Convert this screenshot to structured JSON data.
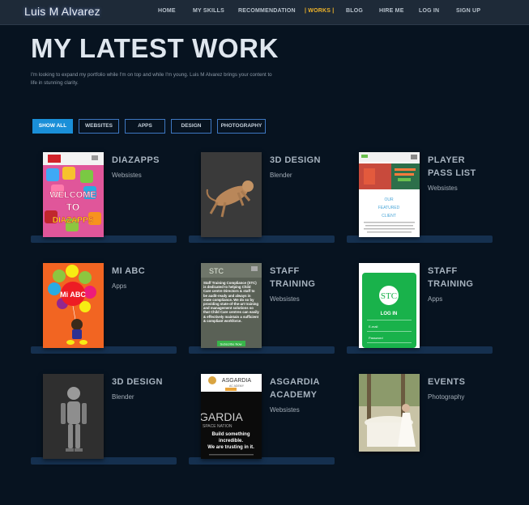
{
  "brand": "Luis M Alvarez",
  "nav": {
    "items": [
      "HOME",
      "MY SKILLS",
      "RECOMMENDATION",
      "| WORKS |",
      "BLOG",
      "HIRE ME",
      "LOG IN",
      "SIGN UP"
    ],
    "active": "| WORKS |",
    "active_color": "#f0b429"
  },
  "hero": {
    "title": "MY LATEST WORK",
    "subtitle": "I'm looking to expand my portfolio while I'm on top and while I'm young. Luis M Alvarez brings your content to life in stunning clarity."
  },
  "filters": [
    "SHOW ALL",
    "WEBSITES",
    "APPS",
    "DESIGN",
    "PHOTOGRAPHY"
  ],
  "filter_active": "SHOW ALL",
  "works": [
    {
      "title": "DIAZAPPS",
      "category": "Websistes",
      "thumb_text": "WELCOME TO DIAZAPPS",
      "thumb_icon": "app-icons-collage"
    },
    {
      "title": "3D DESIGN",
      "category": "Blender",
      "thumb_icon": "3d-creature-render"
    },
    {
      "title": "PLAYER PASS LIST",
      "category": "Websistes",
      "thumb_text": "OUR FEATURED CLIENT",
      "thumb_icon": "website-screenshot"
    },
    {
      "title": "MI ABC",
      "category": "Apps",
      "thumb_text": "Mi ABC",
      "thumb_icon": "balloons-character"
    },
    {
      "title": "STAFF TRAINING",
      "category": "Websistes",
      "thumb_text": "Staff Training Compliance (STC) is dedicated to helping Child Care centre Directors & staff to be audit-ready and always in state compliance. We do so by providing state-of-the-art training and management solutions so that Child Care centres can easily & effectively maintain a sufficient & compliant workforce.",
      "thumb_button": "Subscribe Now",
      "thumb_icon": "stc-website"
    },
    {
      "title": "STAFF TRAINING",
      "category": "Apps",
      "thumb_logo": "STC",
      "thumb_heading": "LOG IN",
      "thumb_field1": "E-mail",
      "thumb_field2": "Password",
      "thumb_icon": "stc-app-login"
    },
    {
      "title": "3D DESIGN",
      "category": "Blender",
      "thumb_icon": "3d-robot-render"
    },
    {
      "title": "ASGARDIA ACADEMY",
      "category": "Websistes",
      "thumb_header": "ASGARDIA",
      "thumb_sub": "AC ADEMY",
      "thumb_big": "GARDIA",
      "thumb_big2": "SPACE NATION",
      "thumb_line1": "Build something",
      "thumb_line2": "incredible.",
      "thumb_line3": "We are trusting in it.",
      "thumb_icon": "asgardia-website"
    },
    {
      "title": "EVENTS",
      "category": "Photography",
      "thumb_icon": "event-photo"
    }
  ]
}
